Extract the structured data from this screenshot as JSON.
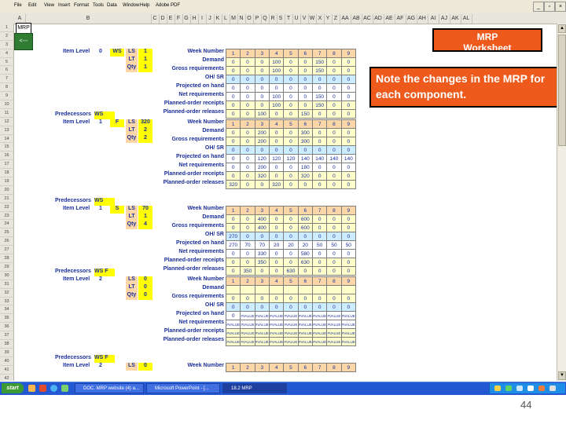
{
  "app": {
    "menu": [
      "File",
      "Edit",
      "View",
      "Insert",
      "Format",
      "Tools",
      "Data",
      "Window",
      "Help",
      "Adobe PDF"
    ]
  },
  "colhdr": [
    "A",
    "B",
    "C",
    "D",
    "E",
    "F",
    "G",
    "H",
    "I",
    "J",
    "K",
    "L",
    "M",
    "N",
    "O",
    "P",
    "Q",
    "R",
    "S",
    "T",
    "U",
    "V",
    "W",
    "X",
    "Y",
    "Z",
    "AA",
    "AB",
    "AC",
    "AD",
    "AE",
    "AF",
    "AG",
    "AH",
    "AI",
    "AJ",
    "AK",
    "AL"
  ],
  "rows": [
    "1",
    "2",
    "3",
    "4",
    "5",
    "6",
    "7",
    "8",
    "9",
    "10",
    "11",
    "12",
    "13",
    "14",
    "15",
    "16",
    "17",
    "18",
    "19",
    "20",
    "21",
    "22",
    "23",
    "24",
    "25",
    "26",
    "27",
    "28",
    "29",
    "30",
    "31",
    "32",
    "33",
    "34",
    "35",
    "36",
    "37",
    "38",
    "39",
    "40",
    "41",
    "42"
  ],
  "cell_a1": "MRP",
  "back_btn": "<---",
  "mrp_box": {
    "line1": "MRP",
    "line2": "Worksheet"
  },
  "note_box": "Note the changes in the MRP for each component.",
  "page_number": "44",
  "rowlabels": [
    "Week Number",
    "Demand",
    "Gross requirements",
    "OH/ SR",
    "Projected on hand",
    "Net requirements",
    "Planned-order receipts",
    "Planned-order releases"
  ],
  "weeks": [
    "1",
    "2",
    "3",
    "4",
    "5",
    "6",
    "7",
    "8",
    "9"
  ],
  "blocks": [
    {
      "predecessors": "",
      "item_level": "0",
      "item_code": "WS",
      "ls": "1",
      "lt": "1",
      "qty": "1",
      "rows": [
        [
          "1",
          "2",
          "3",
          "4",
          "5",
          "6",
          "7",
          "8",
          "9"
        ],
        [
          "0",
          "0",
          "0",
          "100",
          "0",
          "0",
          "150",
          "0",
          "0"
        ],
        [
          "0",
          "0",
          "0",
          "100",
          "0",
          "0",
          "150",
          "0",
          "0"
        ],
        [
          "0",
          "0",
          "0",
          "0",
          "0",
          "0",
          "0",
          "0",
          "0"
        ],
        [
          "0",
          "0",
          "0",
          "0",
          "0",
          "0",
          "0",
          "0",
          "0"
        ],
        [
          "0",
          "0",
          "0",
          "100",
          "0",
          "0",
          "150",
          "0",
          "0"
        ],
        [
          "0",
          "0",
          "0",
          "100",
          "0",
          "0",
          "150",
          "0",
          "0"
        ],
        [
          "0",
          "0",
          "100",
          "0",
          "0",
          "150",
          "0",
          "0",
          "0"
        ]
      ]
    },
    {
      "predecessors": "WS",
      "item_level": "1",
      "item_code": "F",
      "ls": "320",
      "lt": "2",
      "qty": "2",
      "rows": [
        [
          "1",
          "2",
          "3",
          "4",
          "5",
          "6",
          "7",
          "8",
          "9"
        ],
        [
          "0",
          "0",
          "200",
          "0",
          "0",
          "300",
          "0",
          "0",
          "0"
        ],
        [
          "0",
          "0",
          "200",
          "0",
          "0",
          "300",
          "0",
          "0",
          "0"
        ],
        [
          "0",
          "0",
          "0",
          "0",
          "0",
          "0",
          "0",
          "0",
          "0"
        ],
        [
          "0",
          "0",
          "120",
          "120",
          "120",
          "140",
          "140",
          "140",
          "140"
        ],
        [
          "0",
          "0",
          "200",
          "0",
          "0",
          "180",
          "0",
          "0",
          "0"
        ],
        [
          "0",
          "0",
          "320",
          "0",
          "0",
          "320",
          "0",
          "0",
          "0"
        ],
        [
          "320",
          "0",
          "0",
          "320",
          "0",
          "0",
          "0",
          "0",
          "0"
        ]
      ]
    },
    {
      "predecessors": "WS",
      "item_level": "1",
      "item_code": "S",
      "ls": "70",
      "lt": "1",
      "qty": "4",
      "rows": [
        [
          "1",
          "2",
          "3",
          "4",
          "5",
          "6",
          "7",
          "8",
          "9"
        ],
        [
          "0",
          "0",
          "400",
          "0",
          "0",
          "600",
          "0",
          "0",
          "0"
        ],
        [
          "0",
          "0",
          "400",
          "0",
          "0",
          "600",
          "0",
          "0",
          "0"
        ],
        [
          "270",
          "0",
          "0",
          "0",
          "0",
          "0",
          "0",
          "0",
          "0"
        ],
        [
          "270",
          "70",
          "70",
          "20",
          "20",
          "20",
          "50",
          "50",
          "50"
        ],
        [
          "0",
          "0",
          "330",
          "0",
          "0",
          "580",
          "0",
          "0",
          "0"
        ],
        [
          "0",
          "0",
          "350",
          "0",
          "0",
          "630",
          "0",
          "0",
          "0"
        ],
        [
          "0",
          "350",
          "0",
          "0",
          "630",
          "0",
          "0",
          "0",
          "0"
        ]
      ]
    },
    {
      "predecessors": "WS   F",
      "item_level": "2",
      "item_code": "",
      "ls": "0",
      "lt": "0",
      "qty": "0",
      "rows": [
        [
          "1",
          "2",
          "3",
          "4",
          "5",
          "6",
          "7",
          "8",
          "9"
        ],
        [
          "",
          "",
          "",
          "",
          "",
          "",
          "",
          "",
          ""
        ],
        [
          "0",
          "0",
          "0",
          "0",
          "0",
          "0",
          "0",
          "0",
          "0"
        ],
        [
          "0",
          "0",
          "0",
          "0",
          "0",
          "0",
          "0",
          "0",
          "0"
        ],
        [
          "0",
          "#VALUE",
          "#VALUE",
          "#VALUE",
          "#VALUE",
          "#VALUE",
          "#VALUE",
          "#VALUE",
          "#VALUE"
        ],
        [
          "#VALUE",
          "#VALUE",
          "#VALUE",
          "#VALUE",
          "#VALUE",
          "#VALUE",
          "#VALUE",
          "#VALUE",
          "#VALUE"
        ],
        [
          "#VALUE",
          "#VALUE",
          "#VALUE",
          "#VALUE",
          "#VALUE",
          "#VALUE",
          "#VALUE",
          "#VALUE",
          "#VALUE"
        ],
        [
          "#VALUE",
          "#VALUE",
          "#VALUE",
          "#VALUE",
          "#VALUE",
          "#VALUE",
          "#VALUE",
          "#VALUE",
          "#VALUE"
        ]
      ]
    },
    {
      "predecessors": "WS   F",
      "item_level": "2",
      "item_code": "",
      "ls": "0",
      "lt": "",
      "qty": "",
      "rows": [
        [
          "1",
          "2",
          "3",
          "4",
          "5",
          "6",
          "7",
          "8",
          "9"
        ]
      ]
    }
  ],
  "taskbar": {
    "start": "start",
    "items": [
      "DOC. MRP website (4) a...",
      "Microsoft PowerPoint - [...",
      "18.2 MRP"
    ],
    "tray_time": ""
  }
}
